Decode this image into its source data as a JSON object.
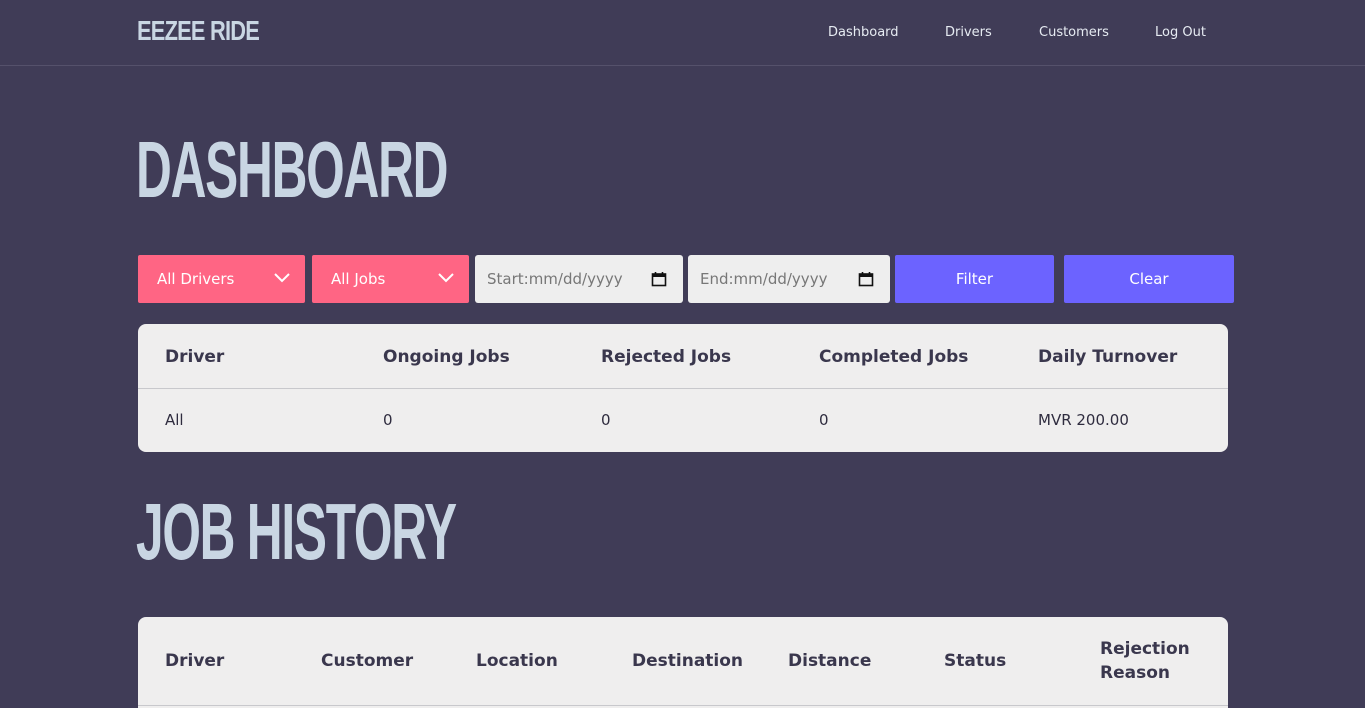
{
  "app": {
    "logo": "EEZEE RIDE"
  },
  "nav": {
    "items": [
      {
        "label": "Dashboard"
      },
      {
        "label": "Drivers"
      },
      {
        "label": "Customers"
      },
      {
        "label": "Log Out"
      }
    ]
  },
  "page": {
    "title": "DASHBOARD"
  },
  "filters": {
    "driver_select": "All Drivers",
    "job_select": "All Jobs",
    "start_date": "Start:mm/dd/yyyy",
    "end_date": "End:mm/dd/yyyy",
    "filter_label": "Filter",
    "clear_label": "Clear"
  },
  "stats_table": {
    "headers": [
      "Driver",
      "Ongoing Jobs",
      "Rejected Jobs",
      "Completed Jobs",
      "Daily Turnover"
    ],
    "rows": [
      [
        "All",
        "0",
        "0",
        "0",
        "MVR 200.00"
      ]
    ]
  },
  "history": {
    "title": "JOB HISTORY",
    "headers": [
      "Driver",
      "Customer",
      "Location",
      "Destination",
      "Distance",
      "Status",
      "Rejection Reason"
    ]
  },
  "colors": {
    "background": "#403c57",
    "accent_pink": "#ff6584",
    "accent_purple": "#6c63ff",
    "card": "#efeeee"
  }
}
